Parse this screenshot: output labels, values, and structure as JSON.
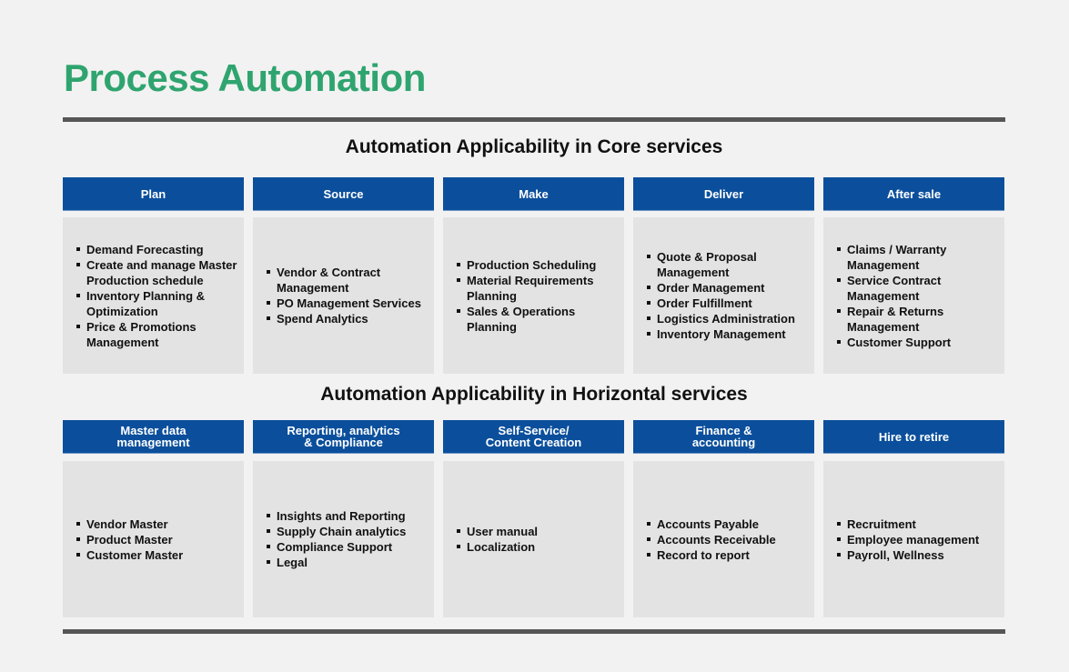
{
  "title": "Process Automation",
  "sections": {
    "core": {
      "title": "Automation Applicability in Core services",
      "columns": [
        {
          "header": "Plan",
          "items": [
            "Demand Forecasting",
            "Create and manage Master Production schedule",
            "Inventory Planning & Optimization",
            "Price & Promotions Management"
          ]
        },
        {
          "header": "Source",
          "items": [
            "Vendor & Contract Management",
            "PO Management Services",
            "Spend Analytics"
          ]
        },
        {
          "header": "Make",
          "items": [
            "Production Scheduling",
            "Material Requirements Planning",
            "Sales & Operations Planning"
          ]
        },
        {
          "header": "Deliver",
          "items": [
            "Quote & Proposal Management",
            "Order Management",
            "Order Fulfillment",
            "Logistics Administration",
            "Inventory Management"
          ]
        },
        {
          "header": "After sale",
          "items": [
            "Claims / Warranty Management",
            "Service Contract Management",
            "Repair & Returns Management",
            "Customer Support"
          ]
        }
      ]
    },
    "horizontal": {
      "title": "Automation Applicability in Horizontal services",
      "columns": [
        {
          "header": "Master data management",
          "items": [
            "Vendor Master",
            "Product Master",
            "Customer Master"
          ]
        },
        {
          "header": "Reporting, analytics & Compliance",
          "items": [
            "Insights and Reporting",
            "Supply Chain analytics",
            "Compliance Support",
            "Legal"
          ]
        },
        {
          "header": "Self-Service/ Content Creation",
          "items": [
            "User manual",
            "Localization"
          ]
        },
        {
          "header": "Finance & accounting",
          "items": [
            "Accounts Payable",
            "Accounts Receivable",
            "Record to report"
          ]
        },
        {
          "header": "Hire to retire",
          "items": [
            "Recruitment",
            "Employee management",
            "Payroll, Wellness"
          ]
        }
      ]
    }
  },
  "colors": {
    "title_green": "#2fa46f",
    "header_blue": "#0b4f9c",
    "box_gray": "#e3e3e3",
    "rule_gray": "#565656",
    "background": "#f2f2f2"
  }
}
